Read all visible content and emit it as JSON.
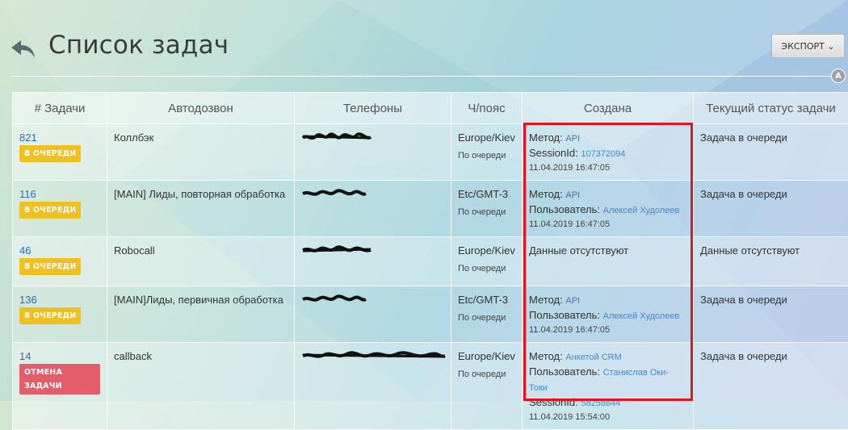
{
  "header": {
    "title": "Список задач",
    "export_label": "ЭКСПОРТ ⌄",
    "a_badge": "A"
  },
  "table": {
    "columns": [
      "# Задачи",
      "Автодозвон",
      "Телефоны",
      "Ч/пояс",
      "Создана",
      "Текущий статус задачи"
    ],
    "rows": [
      {
        "id": "821",
        "badge": "В ОЧЕРЕДИ",
        "badge_type": "queue",
        "campaign": "Коллбэк",
        "timezone": "Europe/Kiev",
        "tz_status": "По очереди",
        "method_label": "Метод:",
        "method_value": "API",
        "extra_label": "SessionId:",
        "extra_value": "107372094",
        "created_at": "11.04.2019 16:47:05",
        "status": "Задача в очереди"
      },
      {
        "id": "116",
        "badge": "В ОЧЕРЕДИ",
        "badge_type": "queue",
        "campaign": "[MAIN] Лиды, повторная обработка",
        "timezone": "Etc/GMT-3",
        "tz_status": "По очереди",
        "method_label": "Метод:",
        "method_value": "API",
        "extra_label": "Пользователь:",
        "extra_value": "Алексей Худолеев",
        "created_at": "11.04.2019 16:47:05",
        "status": "Задача в очереди"
      },
      {
        "id": "46",
        "badge": "В ОЧЕРЕДИ",
        "badge_type": "queue",
        "campaign": "Robocall",
        "timezone": "Europe/Kiev",
        "tz_status": "По очереди",
        "no_data": "Данные отсутствуют",
        "status": "Данные отсутствуют"
      },
      {
        "id": "136",
        "badge": "В ОЧЕРЕДИ",
        "badge_type": "queue",
        "campaign": "[MAIN]Лиды, первичная обработка",
        "timezone": "Etc/GMT-3",
        "tz_status": "По очереди",
        "method_label": "Метод:",
        "method_value": "API",
        "extra_label": "Пользователь:",
        "extra_value": "Алексей Худолеев",
        "created_at": "11.04.2019 16:47:05",
        "status": "Задача в очереди"
      },
      {
        "id": "14",
        "badge": "ОТМЕНА ЗАДАЧИ",
        "badge_type": "cancel",
        "campaign": "callback",
        "timezone": "Europe/Kiev",
        "tz_status": "По очереди",
        "method_label": "Метод:",
        "method_value": "Анкетой CRM",
        "extra_label": "Пользователь:",
        "extra_value": "Станислав Оки-Токи",
        "extra2_label": "SessionId:",
        "extra2_value": "58258644",
        "created_at": "11.04.2019 15:54:00",
        "status": "Задача в очереди"
      }
    ]
  },
  "colors": {
    "link": "#2c6cb5",
    "queue_badge": "#f0c020",
    "cancel_badge": "#e35d6a",
    "highlight_box": "#e0151f"
  },
  "icons": {
    "back": "back-arrow-icon",
    "export_caret": "chevron-down-icon"
  }
}
